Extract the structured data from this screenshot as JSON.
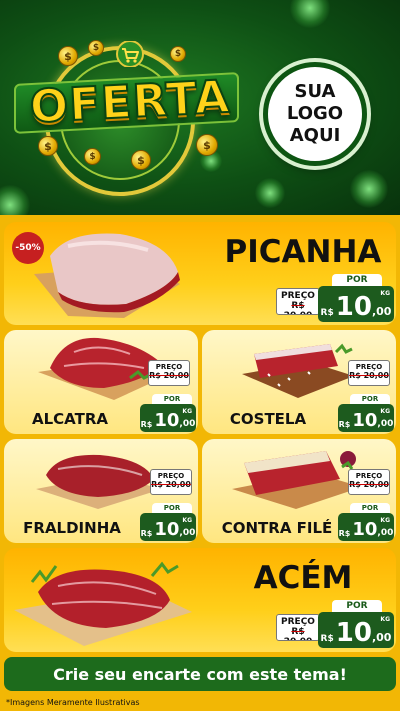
{
  "header": {
    "title": "OFERTA",
    "logo_lines": [
      "SUA",
      "LOGO",
      "AQUI"
    ],
    "coin_symbol": "$",
    "colors": {
      "green_dark": "#0e4f14",
      "gold": "#ffd21a"
    }
  },
  "products": [
    {
      "name": "PICANHA",
      "old_label": "PREÇO",
      "old_price": "R$ 20,00",
      "new_label": "POR",
      "currency": "R$",
      "price_int": "10",
      "price_cents": ",00",
      "unit": "KG",
      "badge": "-50%"
    },
    {
      "name": "ALCATRA",
      "old_label": "PREÇO",
      "old_price": "R$ 20,00",
      "new_label": "POR",
      "currency": "R$",
      "price_int": "10",
      "price_cents": ",00",
      "unit": "KG"
    },
    {
      "name": "COSTELA",
      "old_label": "PREÇO",
      "old_price": "R$ 20,00",
      "new_label": "POR",
      "currency": "R$",
      "price_int": "10",
      "price_cents": ",00",
      "unit": "KG"
    },
    {
      "name": "FRALDINHA",
      "old_label": "PREÇO",
      "old_price": "R$ 20,00",
      "new_label": "POR",
      "currency": "R$",
      "price_int": "10",
      "price_cents": ",00",
      "unit": "KG"
    },
    {
      "name": "CONTRA FILÉ",
      "old_label": "PREÇO",
      "old_price": "R$ 20,00",
      "new_label": "POR",
      "currency": "R$",
      "price_int": "10",
      "price_cents": ",00",
      "unit": "KG"
    },
    {
      "name": "ACÉM",
      "old_label": "PREÇO",
      "old_price": "R$ 20,00",
      "new_label": "POR",
      "currency": "R$",
      "price_int": "10",
      "price_cents": ",00",
      "unit": "KG"
    }
  ],
  "footer": {
    "cta": "Crie seu encarte com este tema!",
    "note": "*Imagens Meramente Ilustrativas"
  }
}
